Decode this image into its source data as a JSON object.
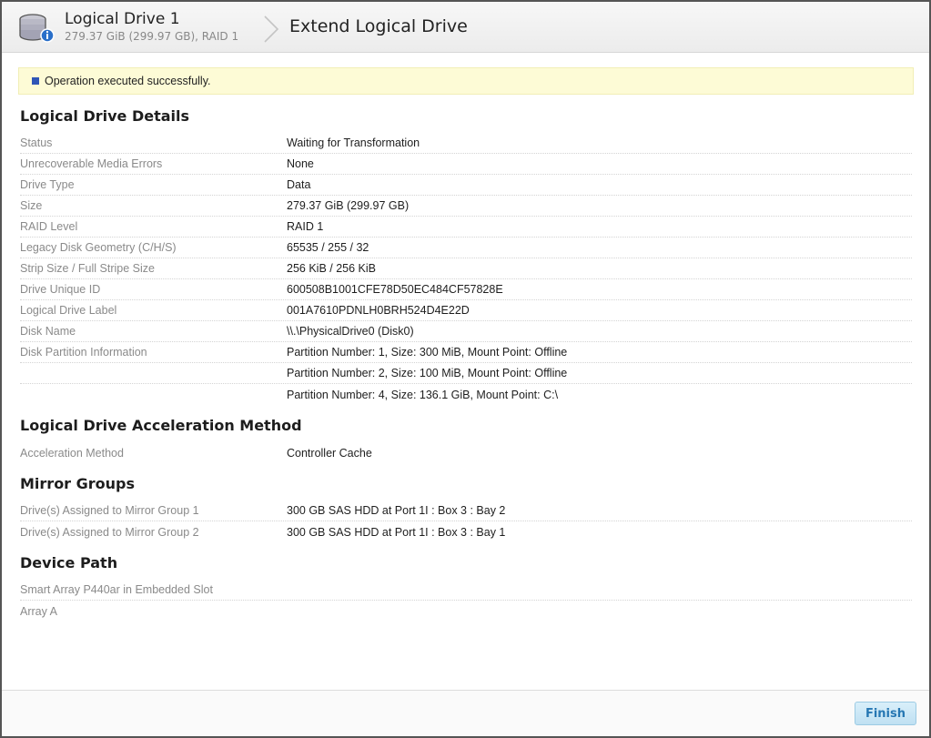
{
  "header": {
    "drive_title": "Logical Drive 1",
    "drive_subtitle": "279.37 GiB (299.97 GB), RAID 1",
    "page_title": "Extend Logical Drive"
  },
  "banner": {
    "message": "Operation executed successfully."
  },
  "sections": {
    "details": {
      "title": "Logical Drive Details",
      "rows": [
        {
          "label": "Status",
          "value": "Waiting for Transformation"
        },
        {
          "label": "Unrecoverable Media Errors",
          "value": "None"
        },
        {
          "label": "Drive Type",
          "value": "Data"
        },
        {
          "label": "Size",
          "value": "279.37 GiB (299.97 GB)"
        },
        {
          "label": "RAID Level",
          "value": "RAID 1"
        },
        {
          "label": "Legacy Disk Geometry (C/H/S)",
          "value": "65535 / 255 / 32"
        },
        {
          "label": "Strip Size / Full Stripe Size",
          "value": "256 KiB / 256 KiB"
        },
        {
          "label": "Drive Unique ID",
          "value": "600508B1001CFE78D50EC484CF57828E"
        },
        {
          "label": "Logical Drive Label",
          "value": "001A7610PDNLH0BRH524D4E22D"
        },
        {
          "label": "Disk Name",
          "value": "\\\\.\\PhysicalDrive0 (Disk0)"
        },
        {
          "label": "Disk Partition Information",
          "value": "Partition Number: 1, Size: 300 MiB, Mount Point: Offline"
        },
        {
          "label": "",
          "value": "Partition Number: 2, Size: 100 MiB, Mount Point: Offline"
        },
        {
          "label": "",
          "value": "Partition Number: 4, Size: 136.1 GiB, Mount Point: C:\\"
        }
      ]
    },
    "acceleration": {
      "title": "Logical Drive Acceleration Method",
      "rows": [
        {
          "label": "Acceleration Method",
          "value": "Controller Cache"
        }
      ]
    },
    "mirror": {
      "title": "Mirror Groups",
      "rows": [
        {
          "label": "Drive(s) Assigned to Mirror Group 1",
          "value": "300 GB SAS HDD at Port 1I : Box 3 : Bay 2"
        },
        {
          "label": "Drive(s) Assigned to Mirror Group 2",
          "value": "300 GB SAS HDD at Port 1I : Box 3 : Bay 1"
        }
      ]
    },
    "device_path": {
      "title": "Device Path",
      "rows": [
        {
          "label": "Smart Array P440ar in Embedded Slot",
          "value": ""
        },
        {
          "label": "Array A",
          "value": ""
        }
      ]
    }
  },
  "footer": {
    "finish_label": "Finish"
  },
  "colors": {
    "banner_bg": "#fdfbd6",
    "banner_marker": "#2f56b6",
    "finish_text": "#2677b3"
  },
  "icons": {
    "drive": "logical-drive-info-icon",
    "breadcrumb": "chevron-right-icon"
  }
}
